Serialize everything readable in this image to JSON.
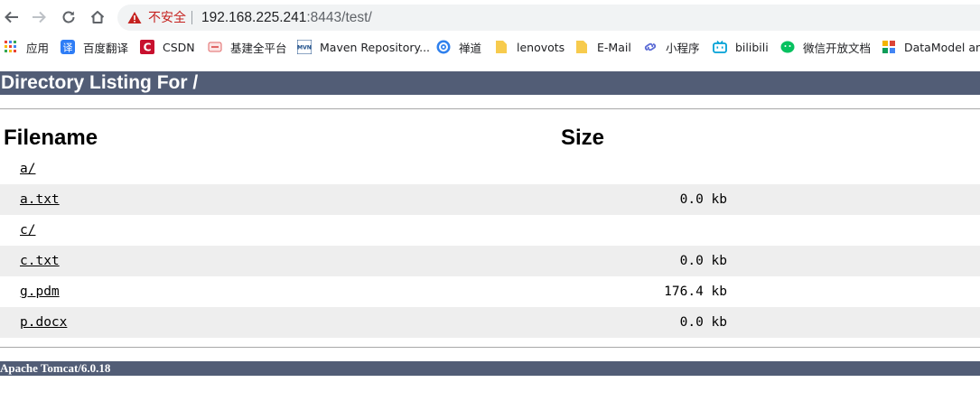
{
  "browser": {
    "security_label": "不安全",
    "url_host": "192.168.225.241",
    "url_rest": ":8443/test/"
  },
  "bookmarks": [
    {
      "label": "应用",
      "icon": "apps-grid-icon",
      "color": "#ea4335"
    },
    {
      "label": "百度翻译",
      "icon": "baidu-translate-icon",
      "color": "#2e7df6"
    },
    {
      "label": "CSDN",
      "icon": "csdn-icon",
      "color": "#c8102e"
    },
    {
      "label": "基建全平台",
      "icon": "site-icon",
      "color": "#e06666"
    },
    {
      "label": "Maven Repository...",
      "icon": "mvn-icon",
      "color": "#1d4e89"
    },
    {
      "label": "禅道",
      "icon": "zentao-icon",
      "color": "#2f80ed"
    },
    {
      "label": "lenovots",
      "icon": "folder-icon",
      "color": "#f7cb4d"
    },
    {
      "label": "E-Mail",
      "icon": "folder-icon",
      "color": "#f7cb4d"
    },
    {
      "label": "小程序",
      "icon": "link-icon",
      "color": "#5b6bd5"
    },
    {
      "label": "bilibili",
      "icon": "bilibili-icon",
      "color": "#00a1d6"
    },
    {
      "label": "微信开放文档",
      "icon": "wechat-icon",
      "color": "#07c160"
    },
    {
      "label": "DataModel any",
      "icon": "datamodel-icon",
      "color": "#f4b400"
    }
  ],
  "page": {
    "title": "Directory Listing For /",
    "col_filename": "Filename",
    "col_size": "Size",
    "rows": [
      {
        "name": "a/",
        "size": ""
      },
      {
        "name": "a.txt",
        "size": "0.0 kb"
      },
      {
        "name": "c/",
        "size": ""
      },
      {
        "name": "c.txt",
        "size": "0.0 kb"
      },
      {
        "name": "g.pdm",
        "size": "176.4 kb"
      },
      {
        "name": "p.docx",
        "size": "0.0 kb"
      }
    ],
    "footer": "Apache Tomcat/6.0.18"
  }
}
